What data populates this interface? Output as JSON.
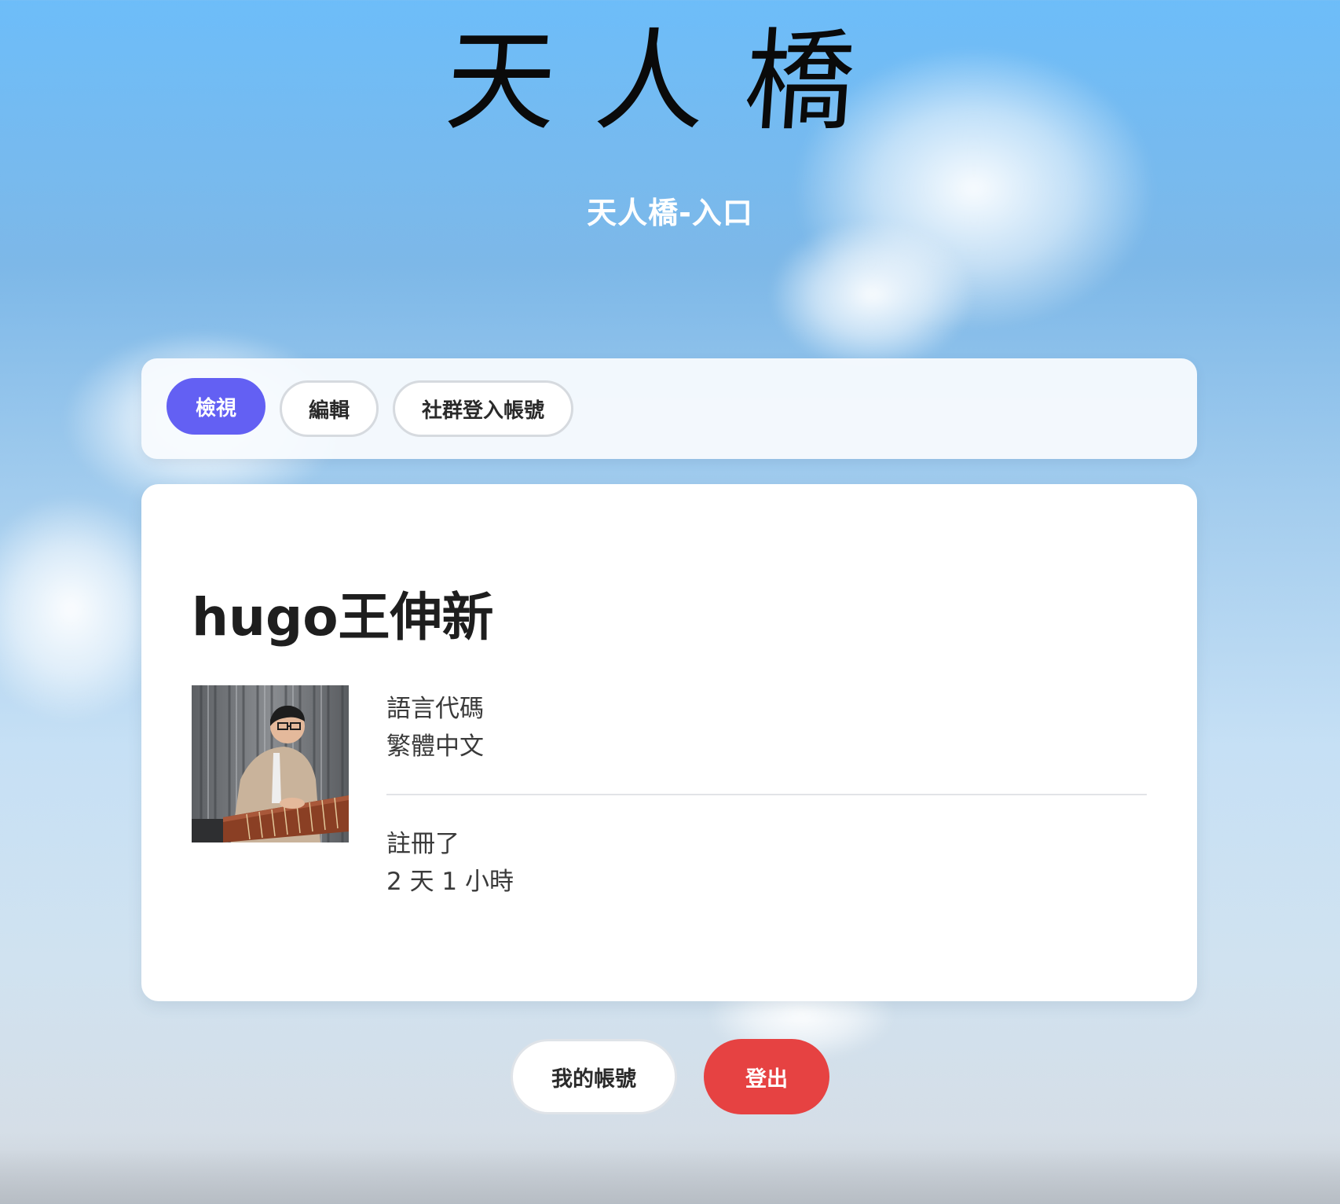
{
  "header": {
    "logo_text": "天人橋",
    "subtitle": "天人橋-入口"
  },
  "tabs": [
    {
      "label": "檢視",
      "active": true
    },
    {
      "label": "編輯",
      "active": false
    },
    {
      "label": "社群登入帳號",
      "active": false
    }
  ],
  "profile": {
    "name": "hugo王伸新",
    "fields": [
      {
        "label": "語言代碼",
        "value": "繁體中文"
      },
      {
        "label": "註冊了",
        "value": "2 天 1 小時"
      }
    ]
  },
  "actions": {
    "account_label": "我的帳號",
    "logout_label": "登出"
  },
  "colors": {
    "active_tab": "#6360f3",
    "logout_button": "#e64242",
    "sky_top": "#6dbdf9"
  }
}
